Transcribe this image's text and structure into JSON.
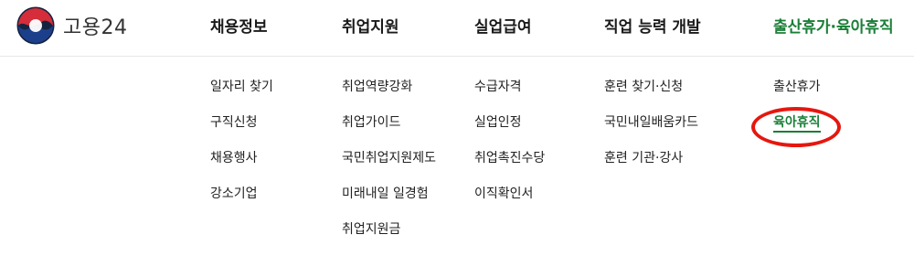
{
  "logo": {
    "text": "고용24",
    "colors": {
      "red": "#d52d3a",
      "blue": "#1b3f8b",
      "dark": "#16233f"
    }
  },
  "gnb": [
    {
      "label": "채용정보"
    },
    {
      "label": "취업지원"
    },
    {
      "label": "실업급여"
    },
    {
      "label": "직업 능력 개발"
    },
    {
      "label": "출산휴가·육아휴직",
      "active": true
    }
  ],
  "submenus": [
    {
      "items": [
        "일자리 찾기",
        "구직신청",
        "채용행사",
        "강소기업"
      ]
    },
    {
      "items": [
        "취업역량강화",
        "취업가이드",
        "국민취업지원제도",
        "미래내일 일경험",
        "취업지원금"
      ]
    },
    {
      "items": [
        "수급자격",
        "실업인정",
        "취업촉진수당",
        "이직확인서"
      ]
    },
    {
      "items": [
        "훈련 찾기·신청",
        "국민내일배움카드",
        "훈련 기관·강사"
      ]
    },
    {
      "items": [
        "출산휴가",
        "육아휴직"
      ],
      "active_index": 1
    }
  ],
  "colors": {
    "active_green": "#1a7f37",
    "annotation_red": "#e5170f"
  }
}
